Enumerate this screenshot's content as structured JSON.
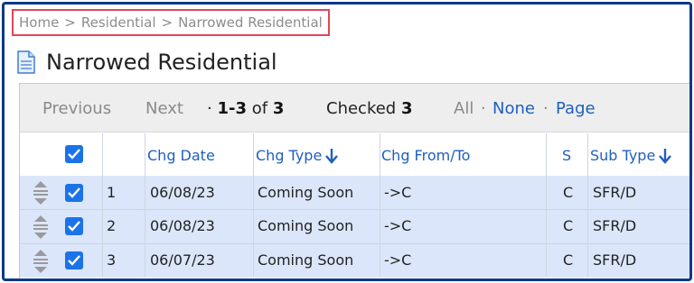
{
  "breadcrumb": {
    "items": [
      "Home",
      "Residential",
      "Narrowed Residential"
    ],
    "separator": ">"
  },
  "page": {
    "title": "Narrowed Residential"
  },
  "toolbar": {
    "previous": "Previous",
    "next": "Next",
    "range_prefix": "·",
    "range": "1-3",
    "of": "of",
    "total": "3",
    "checked_label": "Checked",
    "checked_count": "3",
    "all": "All",
    "dot1": "·",
    "none": "None",
    "dot2": "·",
    "page": "Page"
  },
  "table": {
    "columns": {
      "chg_date": "Chg Date",
      "chg_type": "Chg Type",
      "chg_from_to": "Chg From/To",
      "s": "S",
      "sub_type": "Sub Type"
    },
    "header_checked": true,
    "rows": [
      {
        "num": "1",
        "chg_date": "06/08/23",
        "chg_type": "Coming Soon",
        "chg_from_to": "->C",
        "s": "C",
        "sub_type": "SFR/D",
        "checked": true
      },
      {
        "num": "2",
        "chg_date": "06/08/23",
        "chg_type": "Coming Soon",
        "chg_from_to": "->C",
        "s": "C",
        "sub_type": "SFR/D",
        "checked": true
      },
      {
        "num": "3",
        "chg_date": "06/07/23",
        "chg_type": "Coming Soon",
        "chg_from_to": "->C",
        "s": "C",
        "sub_type": "SFR/D",
        "checked": true
      }
    ]
  },
  "colors": {
    "accent": "#1f5fbf",
    "frame": "#0b3a86",
    "highlight": "#e04556",
    "row_bg": "#dce6fa",
    "checkbox": "#1a73e8"
  }
}
